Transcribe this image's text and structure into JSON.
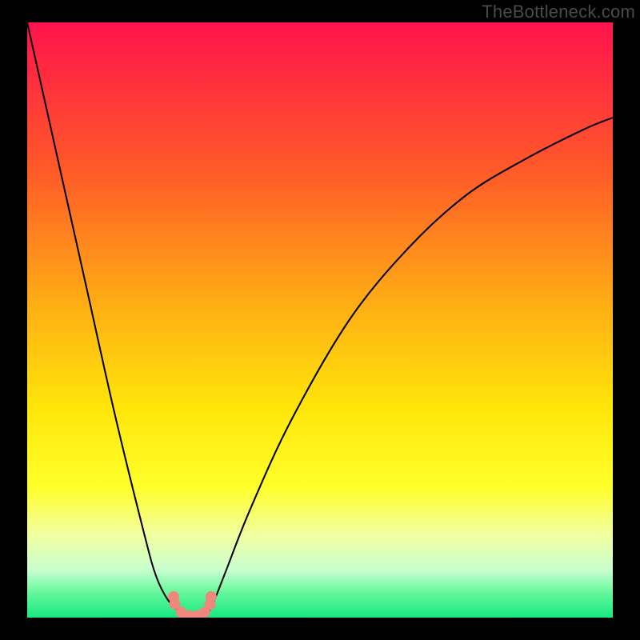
{
  "watermark": {
    "text": "TheBottleneck.com"
  },
  "chart_data": {
    "type": "line",
    "title": "",
    "xlabel": "",
    "ylabel": "",
    "xlim": [
      0,
      100
    ],
    "ylim": [
      0,
      100
    ],
    "grid": false,
    "legend": false,
    "background_gradient": {
      "stops": [
        {
          "pos": 0.0,
          "color": "#ff134c"
        },
        {
          "pos": 0.25,
          "color": "#ff5a28"
        },
        {
          "pos": 0.48,
          "color": "#ffb014"
        },
        {
          "pos": 0.65,
          "color": "#ffe60a"
        },
        {
          "pos": 0.78,
          "color": "#ffff2a"
        },
        {
          "pos": 0.86,
          "color": "#f2ffa0"
        },
        {
          "pos": 0.92,
          "color": "#c8ffcf"
        },
        {
          "pos": 0.96,
          "color": "#61f79a"
        },
        {
          "pos": 1.0,
          "color": "#17e880"
        }
      ]
    },
    "series": [
      {
        "name": "bottleneck-curve",
        "color": "#000000",
        "x": [
          0,
          5,
          10,
          15,
          20,
          22,
          24,
          26,
          27,
          28,
          29,
          30,
          31,
          32,
          34,
          38,
          45,
          55,
          65,
          75,
          85,
          95,
          100
        ],
        "y": [
          100,
          78,
          56,
          34,
          14,
          7,
          3,
          1,
          0.3,
          0,
          0,
          0.2,
          1,
          3,
          8,
          18,
          33,
          50,
          62,
          71,
          77,
          82,
          84
        ]
      }
    ],
    "markers": {
      "name": "sweet-spot-dots",
      "color": "#ef877f",
      "radius": 7,
      "points": [
        {
          "x": 25.0,
          "y": 3.5
        },
        {
          "x": 25.2,
          "y": 2.3
        },
        {
          "x": 26.3,
          "y": 0.9
        },
        {
          "x": 27.6,
          "y": 0.3
        },
        {
          "x": 29.0,
          "y": 0.3
        },
        {
          "x": 30.3,
          "y": 0.9
        },
        {
          "x": 31.2,
          "y": 2.2
        },
        {
          "x": 31.4,
          "y": 3.5
        }
      ]
    }
  }
}
